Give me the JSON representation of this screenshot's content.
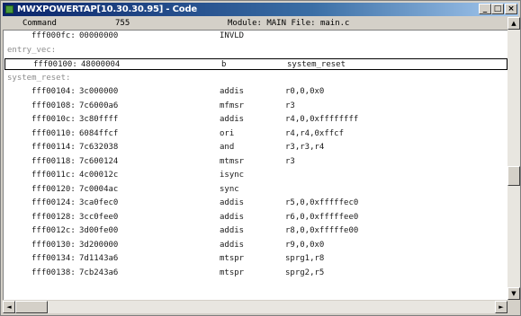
{
  "window": {
    "title": "MWXPOWERTAP[10.30.30.95] - Code",
    "controls": {
      "minimize": "_",
      "maximize": "□",
      "close": "×"
    }
  },
  "header": {
    "command_label": "Command",
    "count": "755",
    "module_text": "Module: MAIN File: main.c"
  },
  "lines": [
    {
      "kind": "code",
      "address": "fff000fc:",
      "opcode": "00000000",
      "mnemonic": "INVLD",
      "operands": ""
    },
    {
      "kind": "label",
      "text": "entry_vec:"
    },
    {
      "kind": "code",
      "address": "fff00100:",
      "opcode": "48000004",
      "mnemonic": "b",
      "operands": "system_reset",
      "selected": true
    },
    {
      "kind": "label",
      "text": "system_reset:"
    },
    {
      "kind": "code",
      "address": "fff00104:",
      "opcode": "3c000000",
      "mnemonic": "addis",
      "operands": "r0,0,0x0"
    },
    {
      "kind": "code",
      "address": "fff00108:",
      "opcode": "7c6000a6",
      "mnemonic": "mfmsr",
      "operands": "r3"
    },
    {
      "kind": "code",
      "address": "fff0010c:",
      "opcode": "3c80ffff",
      "mnemonic": "addis",
      "operands": "r4,0,0xffffffff"
    },
    {
      "kind": "code",
      "address": "fff00110:",
      "opcode": "6084ffcf",
      "mnemonic": "ori",
      "operands": "r4,r4,0xffcf"
    },
    {
      "kind": "code",
      "address": "fff00114:",
      "opcode": "7c632038",
      "mnemonic": "and",
      "operands": "r3,r3,r4"
    },
    {
      "kind": "code",
      "address": "fff00118:",
      "opcode": "7c600124",
      "mnemonic": "mtmsr",
      "operands": "r3"
    },
    {
      "kind": "code",
      "address": "fff0011c:",
      "opcode": "4c00012c",
      "mnemonic": "isync",
      "operands": ""
    },
    {
      "kind": "code",
      "address": "fff00120:",
      "opcode": "7c0004ac",
      "mnemonic": "sync",
      "operands": ""
    },
    {
      "kind": "code",
      "address": "fff00124:",
      "opcode": "3ca0fec0",
      "mnemonic": "addis",
      "operands": "r5,0,0xfffffec0"
    },
    {
      "kind": "code",
      "address": "fff00128:",
      "opcode": "3cc0fee0",
      "mnemonic": "addis",
      "operands": "r6,0,0xfffffee0"
    },
    {
      "kind": "code",
      "address": "fff0012c:",
      "opcode": "3d00fe00",
      "mnemonic": "addis",
      "operands": "r8,0,0xfffffe00"
    },
    {
      "kind": "code",
      "address": "fff00130:",
      "opcode": "3d200000",
      "mnemonic": "addis",
      "operands": "r9,0,0x0"
    },
    {
      "kind": "code",
      "address": "fff00134:",
      "opcode": "7d1143a6",
      "mnemonic": "mtspr",
      "operands": "sprg1,r8"
    },
    {
      "kind": "code",
      "address": "fff00138:",
      "opcode": "7cb243a6",
      "mnemonic": "mtspr",
      "operands": "sprg2,r5"
    }
  ],
  "scrollbars": {
    "up": "▲",
    "down": "▼",
    "left": "◄",
    "right": "►"
  }
}
